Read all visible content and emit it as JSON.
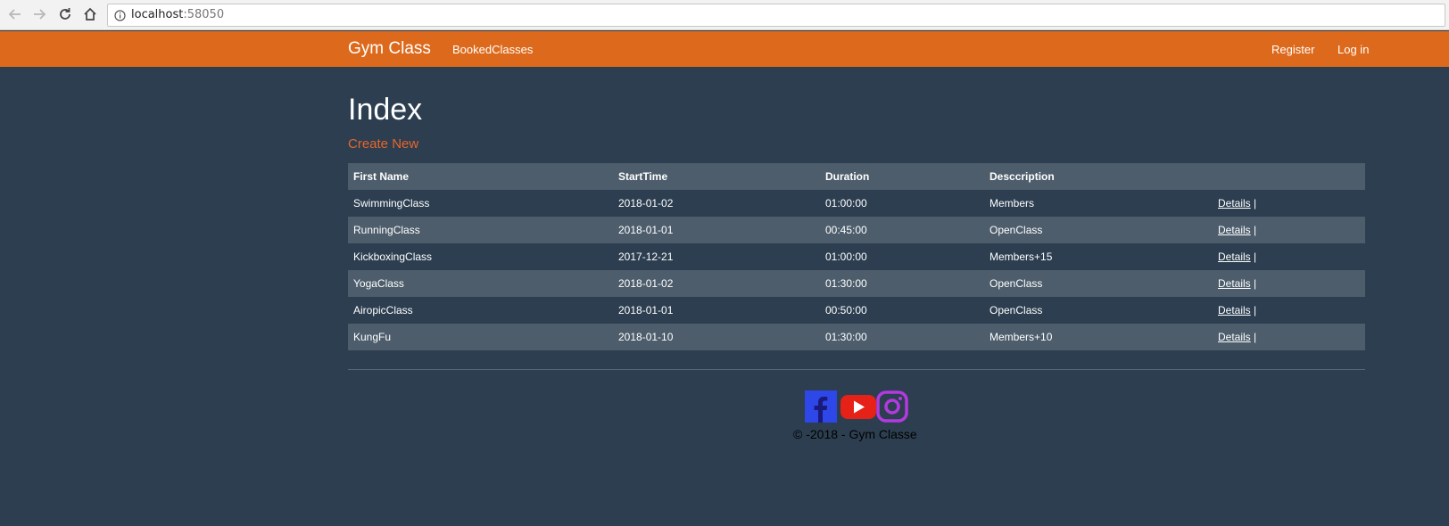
{
  "browser": {
    "url_host": "localhost",
    "url_port": ":58050"
  },
  "navbar": {
    "brand": "Gym Class",
    "links": [
      {
        "label": "BookedClasses"
      }
    ],
    "right_links": [
      {
        "label": "Register"
      },
      {
        "label": "Log in"
      }
    ]
  },
  "main": {
    "title": "Index",
    "create_label": "Create New",
    "table": {
      "headers": [
        "First Name",
        "StartTime",
        "Duration",
        "Desccription",
        ""
      ],
      "rows": [
        {
          "name": "SwimmingClass",
          "start": "2018-01-02",
          "duration": "01:00:00",
          "description": "Members",
          "action": "Details",
          "sep": "|"
        },
        {
          "name": "RunningClass",
          "start": "2018-01-01",
          "duration": "00:45:00",
          "description": "OpenClass",
          "action": "Details",
          "sep": "|"
        },
        {
          "name": "KickboxingClass",
          "start": "2017-12-21",
          "duration": "01:00:00",
          "description": "Members+15",
          "action": "Details",
          "sep": "|"
        },
        {
          "name": "YogaClass",
          "start": "2018-01-02",
          "duration": "01:30:00",
          "description": "OpenClass",
          "action": "Details",
          "sep": "|"
        },
        {
          "name": "AiropicClass",
          "start": "2018-01-01",
          "duration": "00:50:00",
          "description": "OpenClass",
          "action": "Details",
          "sep": "|"
        },
        {
          "name": "KungFu",
          "start": "2018-01-10",
          "duration": "01:30:00",
          "description": "Members+10",
          "action": "Details",
          "sep": "|"
        }
      ]
    }
  },
  "footer": {
    "socials": [
      {
        "icon": "facebook-icon",
        "color": "#1877f2"
      },
      {
        "icon": "youtube-icon",
        "color": "#e62117"
      },
      {
        "icon": "instagram-icon",
        "color": "#c13584"
      }
    ],
    "copyright": "© -2018 - Gym Classe"
  },
  "colors": {
    "navbar": "#dd6a1c",
    "background": "#2c3e50",
    "accent_link": "#e8662a",
    "row_stripe": "#4d5d6c"
  }
}
